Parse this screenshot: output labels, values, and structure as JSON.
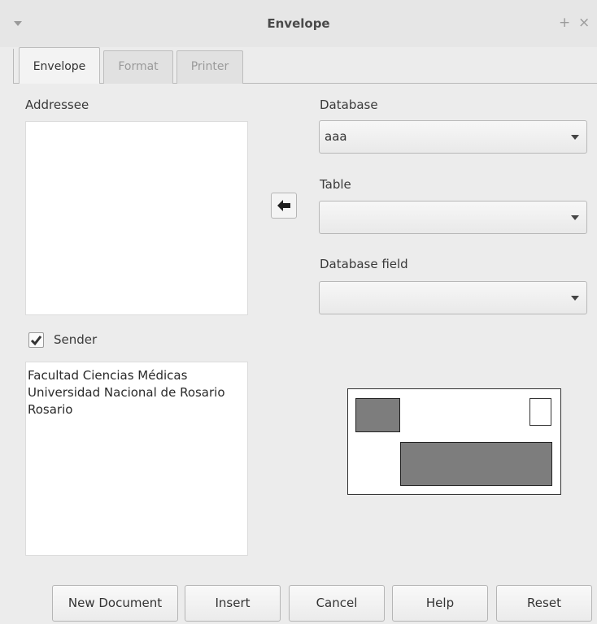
{
  "window": {
    "title": "Envelope",
    "pin_glyph": "+",
    "close_glyph": "×"
  },
  "tabs": [
    {
      "label": "Envelope",
      "active": true
    },
    {
      "label": "Format",
      "active": false
    },
    {
      "label": "Printer",
      "active": false
    }
  ],
  "addressee": {
    "label": "Addressee",
    "text": ""
  },
  "database": {
    "label": "Database",
    "value": "aaa"
  },
  "table": {
    "label": "Table",
    "value": ""
  },
  "database_field": {
    "label": "Database field",
    "value": ""
  },
  "sender": {
    "label": "Sender",
    "checked": true,
    "text": "Facultad Ciencias Médicas\nUniversidad Nacional de Rosario\nRosario"
  },
  "buttons": {
    "new_document": "New Document",
    "insert": "Insert",
    "cancel": "Cancel",
    "help": "Help",
    "reset": "Reset"
  },
  "colors": {
    "window_bg": "#ececec",
    "preview_block": "#7d7d7d"
  },
  "icons": {
    "menu": "chevron-down-icon",
    "pin": "pin-icon",
    "close": "close-icon",
    "insert_arrow": "arrow-left-icon",
    "checkbox": "checkmark-icon"
  }
}
